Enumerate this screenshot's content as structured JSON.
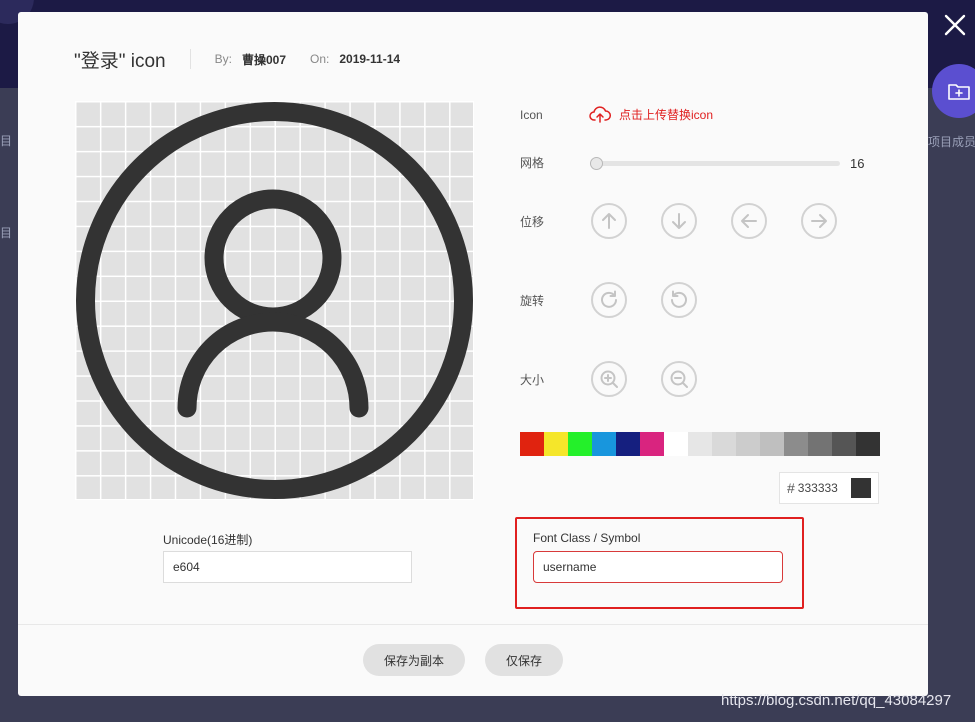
{
  "dialog": {
    "title": "\"登录\" icon",
    "by_label": "By:",
    "author": "曹操007",
    "on_label": "On:",
    "date": "2019-11-14"
  },
  "controls": {
    "icon_label": "Icon",
    "upload_label": "点击上传替换icon",
    "grid_label": "网格",
    "grid_value": "16",
    "grid_fraction": 0.0,
    "move_label": "位移",
    "rotate_label": "旋转",
    "size_label": "大小"
  },
  "palette": [
    "#e0230f",
    "#f5e62a",
    "#24f02a",
    "#1896dd",
    "#151f7f",
    "#d9247f",
    "#ffffff",
    "#e6e6e6",
    "#d9d9d9",
    "#cccccc",
    "#bfbfbf",
    "#8c8c8c",
    "#737373",
    "#555555",
    "#333333"
  ],
  "color": {
    "hash": "#",
    "hex_value": "333333",
    "preview": "#333333"
  },
  "fields": {
    "unicode_label": "Unicode(16进制)",
    "unicode_value": "e604",
    "font_class_label": "Font Class / Symbol",
    "font_class_value": "username"
  },
  "buttons": {
    "save_copy": "保存为副本",
    "save_only": "仅保存"
  },
  "background": {
    "side_label": "项目成员",
    "watermark": "https://blog.csdn.net/qq_43084297"
  },
  "colors": {
    "accent_red": "#e02020",
    "icon_dark": "#333333",
    "header_bg": "#1c1a45",
    "fab_bg": "#5b4fd0"
  },
  "icons": {
    "close": "close-icon",
    "upload": "cloud-upload-icon",
    "move": [
      "arrow-up-icon",
      "arrow-down-icon",
      "arrow-left-icon",
      "arrow-right-icon"
    ],
    "rotate": [
      "rotate-clockwise-icon",
      "rotate-counterclockwise-icon"
    ],
    "size": [
      "zoom-in-icon",
      "zoom-out-icon"
    ],
    "preview": "user-icon"
  }
}
